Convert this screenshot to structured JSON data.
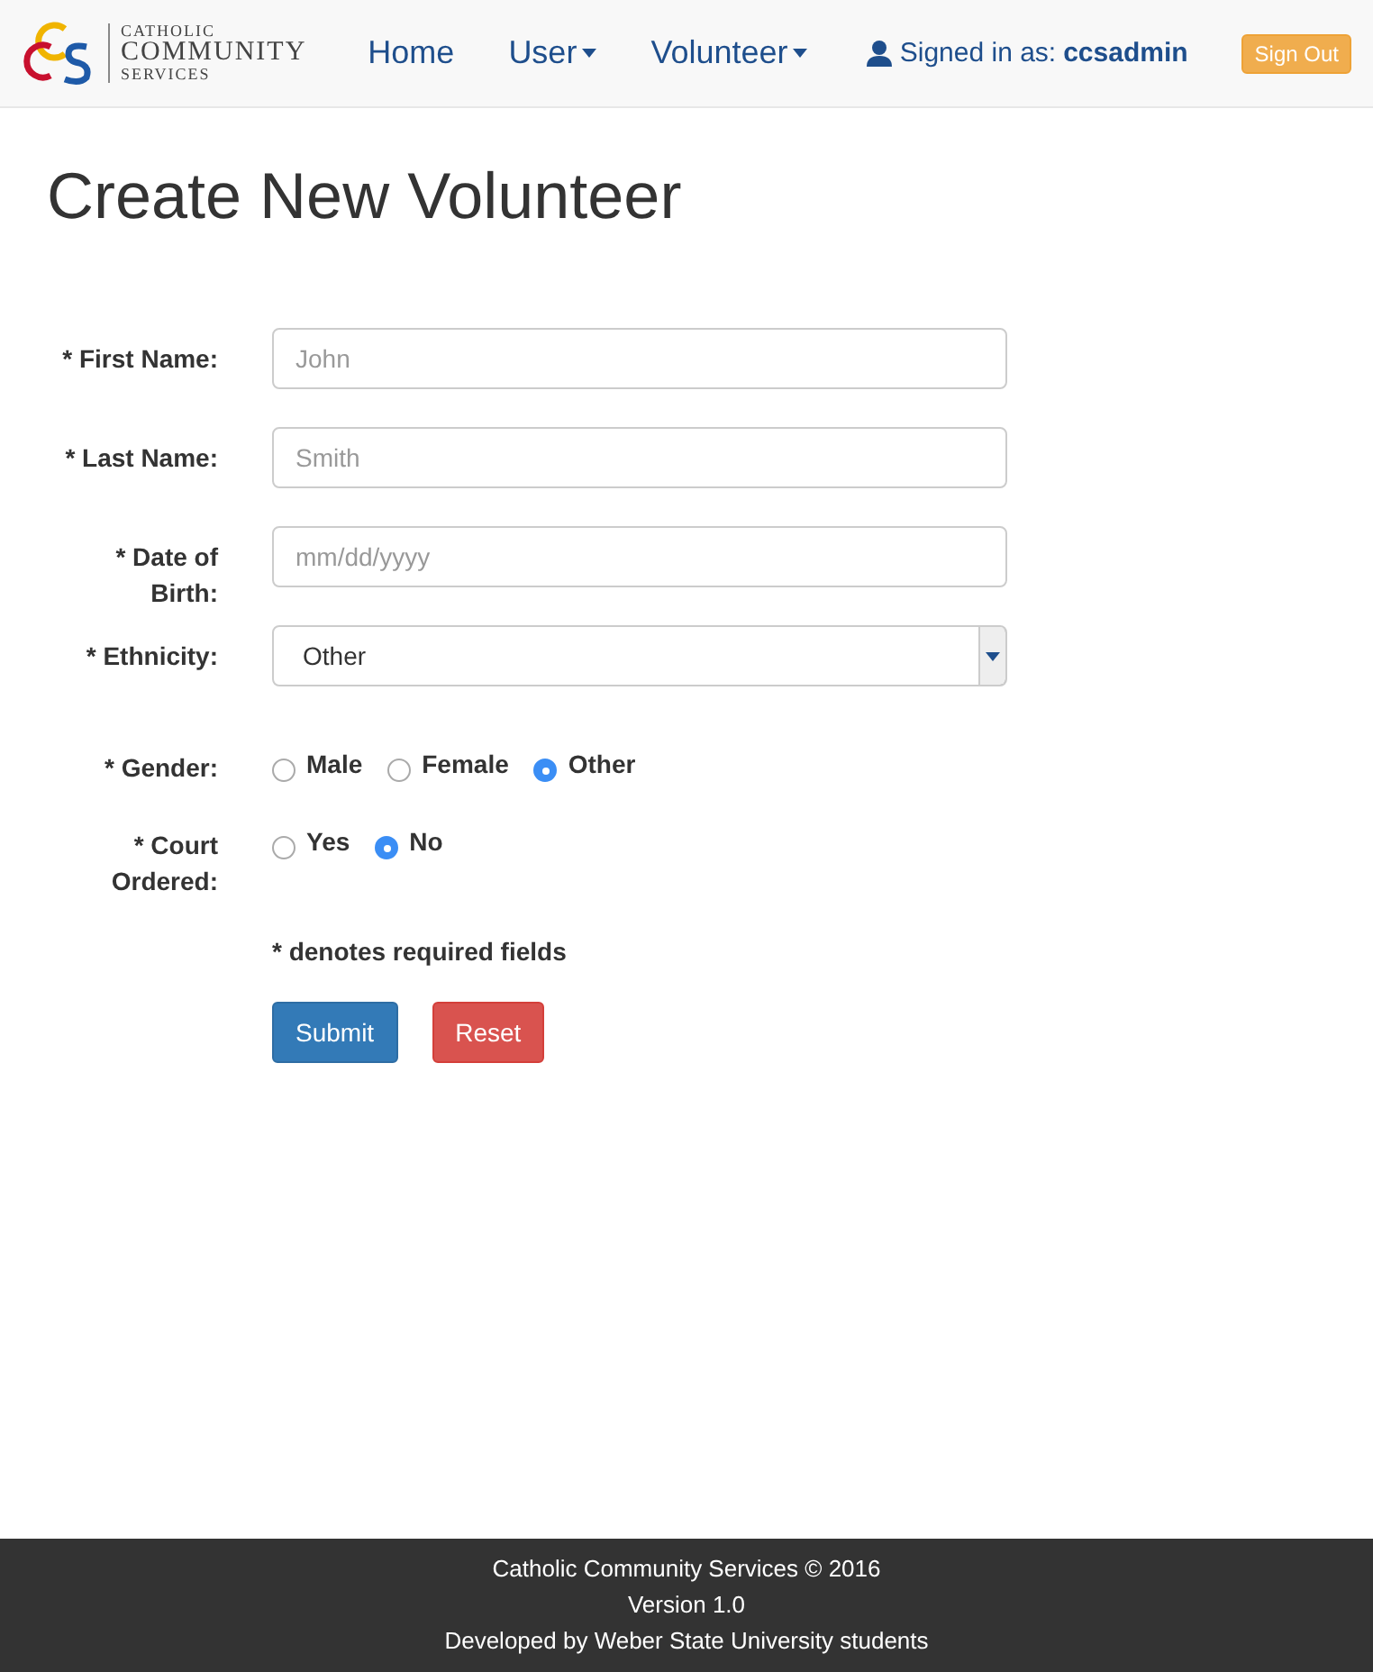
{
  "brand": {
    "line_1": "CATHOLIC",
    "line_2": "COMMUNITY",
    "line_3": "SERVICES"
  },
  "nav": [
    {
      "label": "Home",
      "dropdown": false
    },
    {
      "label": "User",
      "dropdown": true
    },
    {
      "label": "Volunteer",
      "dropdown": true
    }
  ],
  "user": {
    "prefix": "Signed in as:",
    "name": "ccsadmin"
  },
  "sign_out": "Sign Out",
  "title": "Create New Volunteer",
  "fields": [
    {
      "kind": "text",
      "label": "* First Name:",
      "placeholder": "John"
    },
    {
      "kind": "text",
      "label": "* Last Name:",
      "placeholder": "Smith"
    },
    {
      "kind": "text",
      "label": "* Date of Birth:",
      "placeholder": "mm/dd/yyyy"
    },
    {
      "kind": "select",
      "label": "* Ethnicity:",
      "value": "Other"
    },
    {
      "kind": "radio",
      "label": "* Gender:",
      "options": [
        {
          "label": "Male",
          "selected": false
        },
        {
          "label": "Female",
          "selected": false
        },
        {
          "label": "Other",
          "selected": true
        }
      ]
    },
    {
      "kind": "radio",
      "label": "* Court Ordered:",
      "options": [
        {
          "label": "Yes",
          "selected": false
        },
        {
          "label": "No",
          "selected": true
        }
      ]
    }
  ],
  "note": "* denotes required fields",
  "buttons": [
    {
      "label": "Submit",
      "kind": "primary"
    },
    {
      "label": "Reset",
      "kind": "danger"
    }
  ],
  "footer": [
    "Catholic Community Services © 2016",
    "Version 1.0",
    "Developed by Weber State University students"
  ]
}
